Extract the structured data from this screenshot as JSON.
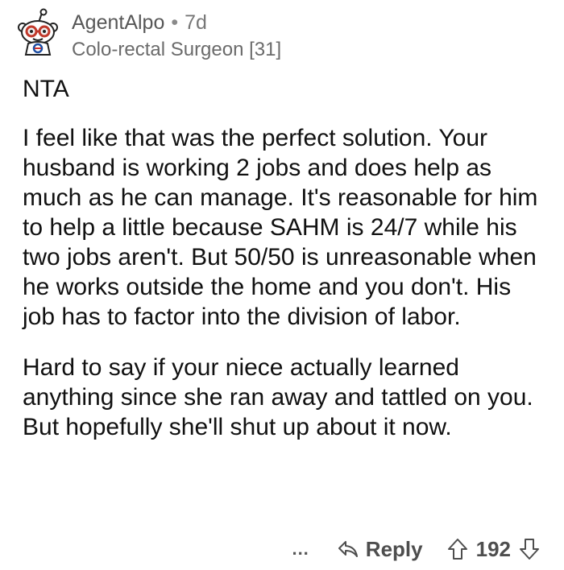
{
  "author": {
    "username": "AgentAlpo",
    "age": "7d",
    "flair": "Colo-rectal Surgeon [31]",
    "avatar_icon": "reddit-snoo-avatar-icon"
  },
  "comment": {
    "paragraphs": [
      "NTA",
      "I feel like that was the perfect solution. Your husband is working 2 jobs and does help as much as he can manage. It's reasonable for him to help a little because SAHM is 24/7 while his two jobs aren't. But 50/50 is unreasonable when he works outside the home and you don't. His job has to factor into the division of labor.",
      "Hard to say if your niece actually learned anything since she ran away and tattled on you. But hopefully she'll shut up about it now."
    ]
  },
  "actions": {
    "more_label": "...",
    "reply_label": "Reply",
    "vote_count": "192"
  },
  "colors": {
    "text": "#111111",
    "meta": "#575757",
    "icon": "#4e4e4e"
  }
}
